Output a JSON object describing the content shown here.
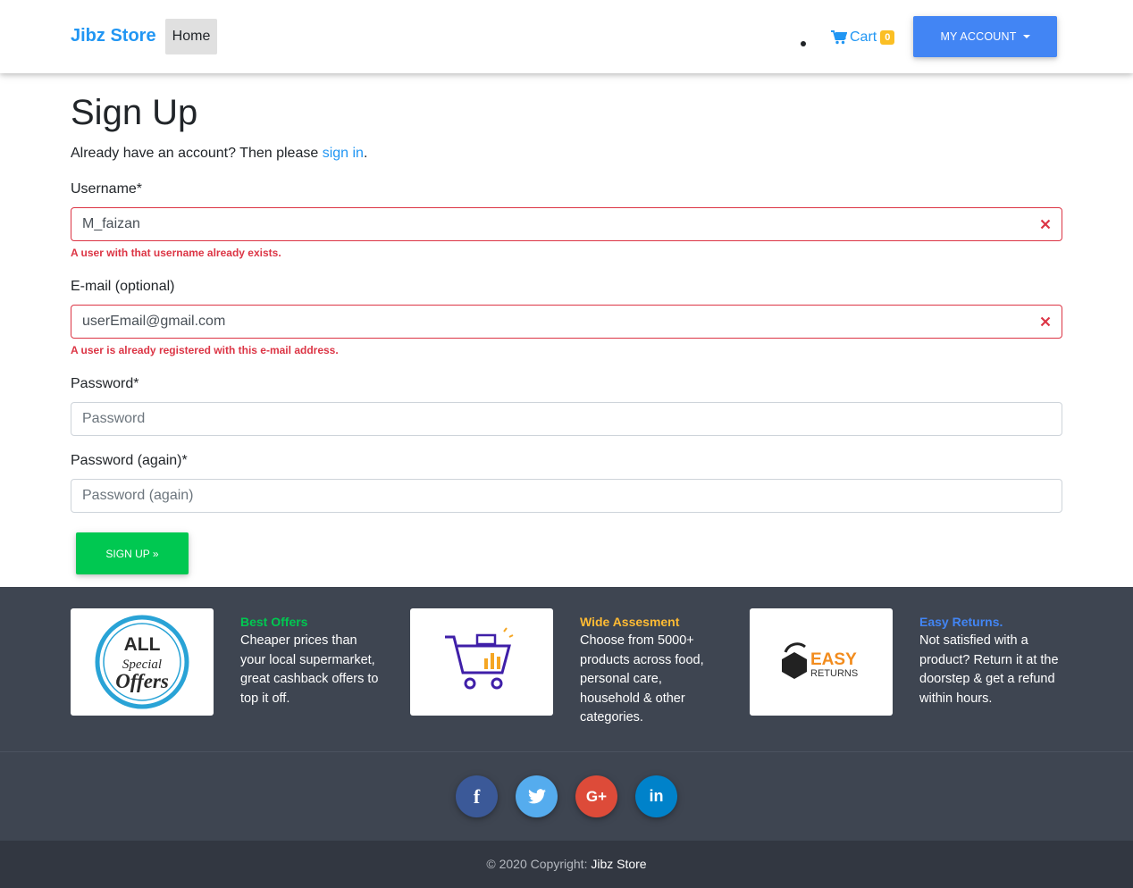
{
  "navbar": {
    "brand": "Jibz Store",
    "home": "Home",
    "cart_label": "Cart",
    "cart_count": "0",
    "account": "MY ACCOUNT"
  },
  "form": {
    "title": "Sign Up",
    "intro_prefix": "Already have an account? Then please ",
    "intro_link": "sign in",
    "intro_suffix": ".",
    "username_label": "Username*",
    "username_value": "M_faizan",
    "username_error": "A user with that username already exists.",
    "email_label": "E-mail (optional)",
    "email_value": "userEmail@gmail.com",
    "email_error": "A user is already registered with this e-mail address.",
    "password_label": "Password*",
    "password_placeholder": "Password",
    "password2_label": "Password (again)*",
    "password2_placeholder": "Password (again)",
    "submit": "SIGN UP »"
  },
  "features": [
    {
      "title": "Best Offers",
      "text": "Cheaper prices than your local supermarket, great cashback offers to top it off.",
      "color": "#00c851",
      "img_text_top": "ALL",
      "img_text_mid": "Special",
      "img_text_bot": "Offers"
    },
    {
      "title": "Wide Assesment",
      "text": "Choose from 5000+ products across food, personal care, household & other categories.",
      "color": "#ffbb33"
    },
    {
      "title": "Easy Returns.",
      "text": "Not satisfied with a product? Return it at the doorstep & get a refund within hours.",
      "color": "#4285f4",
      "img_text_top": "EASY",
      "img_text_bot": "RETURNS"
    }
  ],
  "social": [
    {
      "name": "facebook",
      "glyph": "f",
      "color": "#3b5998"
    },
    {
      "name": "twitter",
      "glyph": "",
      "color": "#55acee"
    },
    {
      "name": "google-plus",
      "glyph": "G+",
      "color": "#dd4b39"
    },
    {
      "name": "linkedin",
      "glyph": "in",
      "color": "#0082ca"
    }
  ],
  "footer": {
    "copyright_prefix": "© 2020 Copyright: ",
    "copyright_link": "Jibz Store"
  }
}
